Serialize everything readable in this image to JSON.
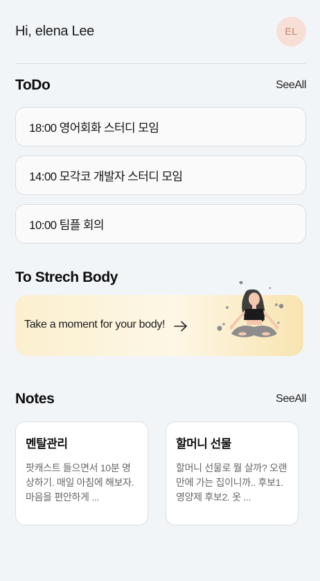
{
  "header": {
    "greeting": "Hi, elena Lee",
    "avatar_initials": "EL"
  },
  "todo": {
    "title": "ToDo",
    "see_all": "SeeAll",
    "items": [
      {
        "label": "18:00 영어회화 스터디 모임"
      },
      {
        "label": "14:00 모각코 개발자 스터디 모임"
      },
      {
        "label": "10:00 팀플 회의"
      }
    ]
  },
  "stretch": {
    "title": "To Strech Body",
    "card_text": "Take a moment for your body!",
    "arrow_icon": "arrow-right-icon",
    "illustration": "meditating-woman"
  },
  "notes": {
    "title": "Notes",
    "see_all": "SeeAll",
    "items": [
      {
        "title": "멘탈관리",
        "body": "팟캐스트 들으면서 10분 명상하기. 매일 아침에 해보자. 마음을 편안하게 ..."
      },
      {
        "title": "할머니 선물",
        "body": "할머니 선물로 뭘 살까? 오랜만에 가는 집이니까.. 후보1. 영양제 후보2. 옷 ..."
      }
    ]
  },
  "colors": {
    "background": "#f2f5f8",
    "avatar_bg": "#f8dfd5",
    "stretch_card": "#fbefcf"
  }
}
